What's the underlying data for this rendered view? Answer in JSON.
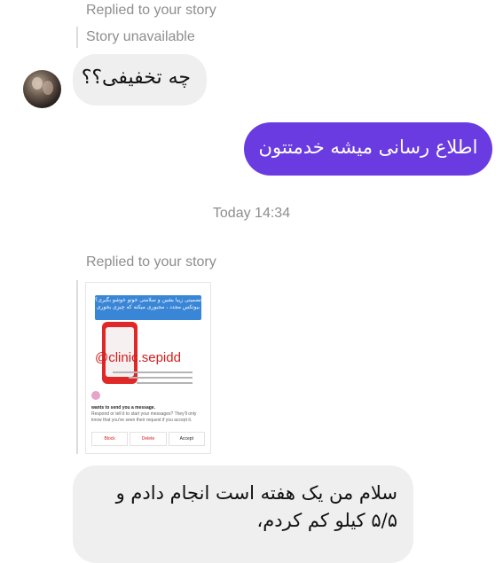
{
  "thread": {
    "reply_label_1": "Replied to your story",
    "story_unavailable": "Story unavailable",
    "msg_in_1": "چه تخفیفی؟؟",
    "msg_out_1": "اطلاع رسانی میشه خدمتتون",
    "date_separator": "Today 14:34",
    "reply_label_2": "Replied to your story",
    "msg_in_2": "سلام من یک هفته است انجام دادم و ۵/۵ کیلو کم کردم،"
  },
  "story_preview": {
    "banner_text": "تضمینی زیبا بشین و سلامتی خوتو خوشو بگیری؟ بیوتکس مجدد ، مجبوری میکنه که چیزی بخوری",
    "handle": "@clinic.sepidd",
    "request_title": "wants to send you a message.",
    "request_body": "Respond or tell it to start your messages? They'll only know that you've seen their request if you accept it.",
    "btn_block": "Block",
    "btn_delete": "Delete",
    "btn_accept": "Accept"
  },
  "colors": {
    "outgoing_bubble": "#6a3be0",
    "incoming_bubble": "#efefef",
    "meta_text": "#8e8e8e"
  }
}
